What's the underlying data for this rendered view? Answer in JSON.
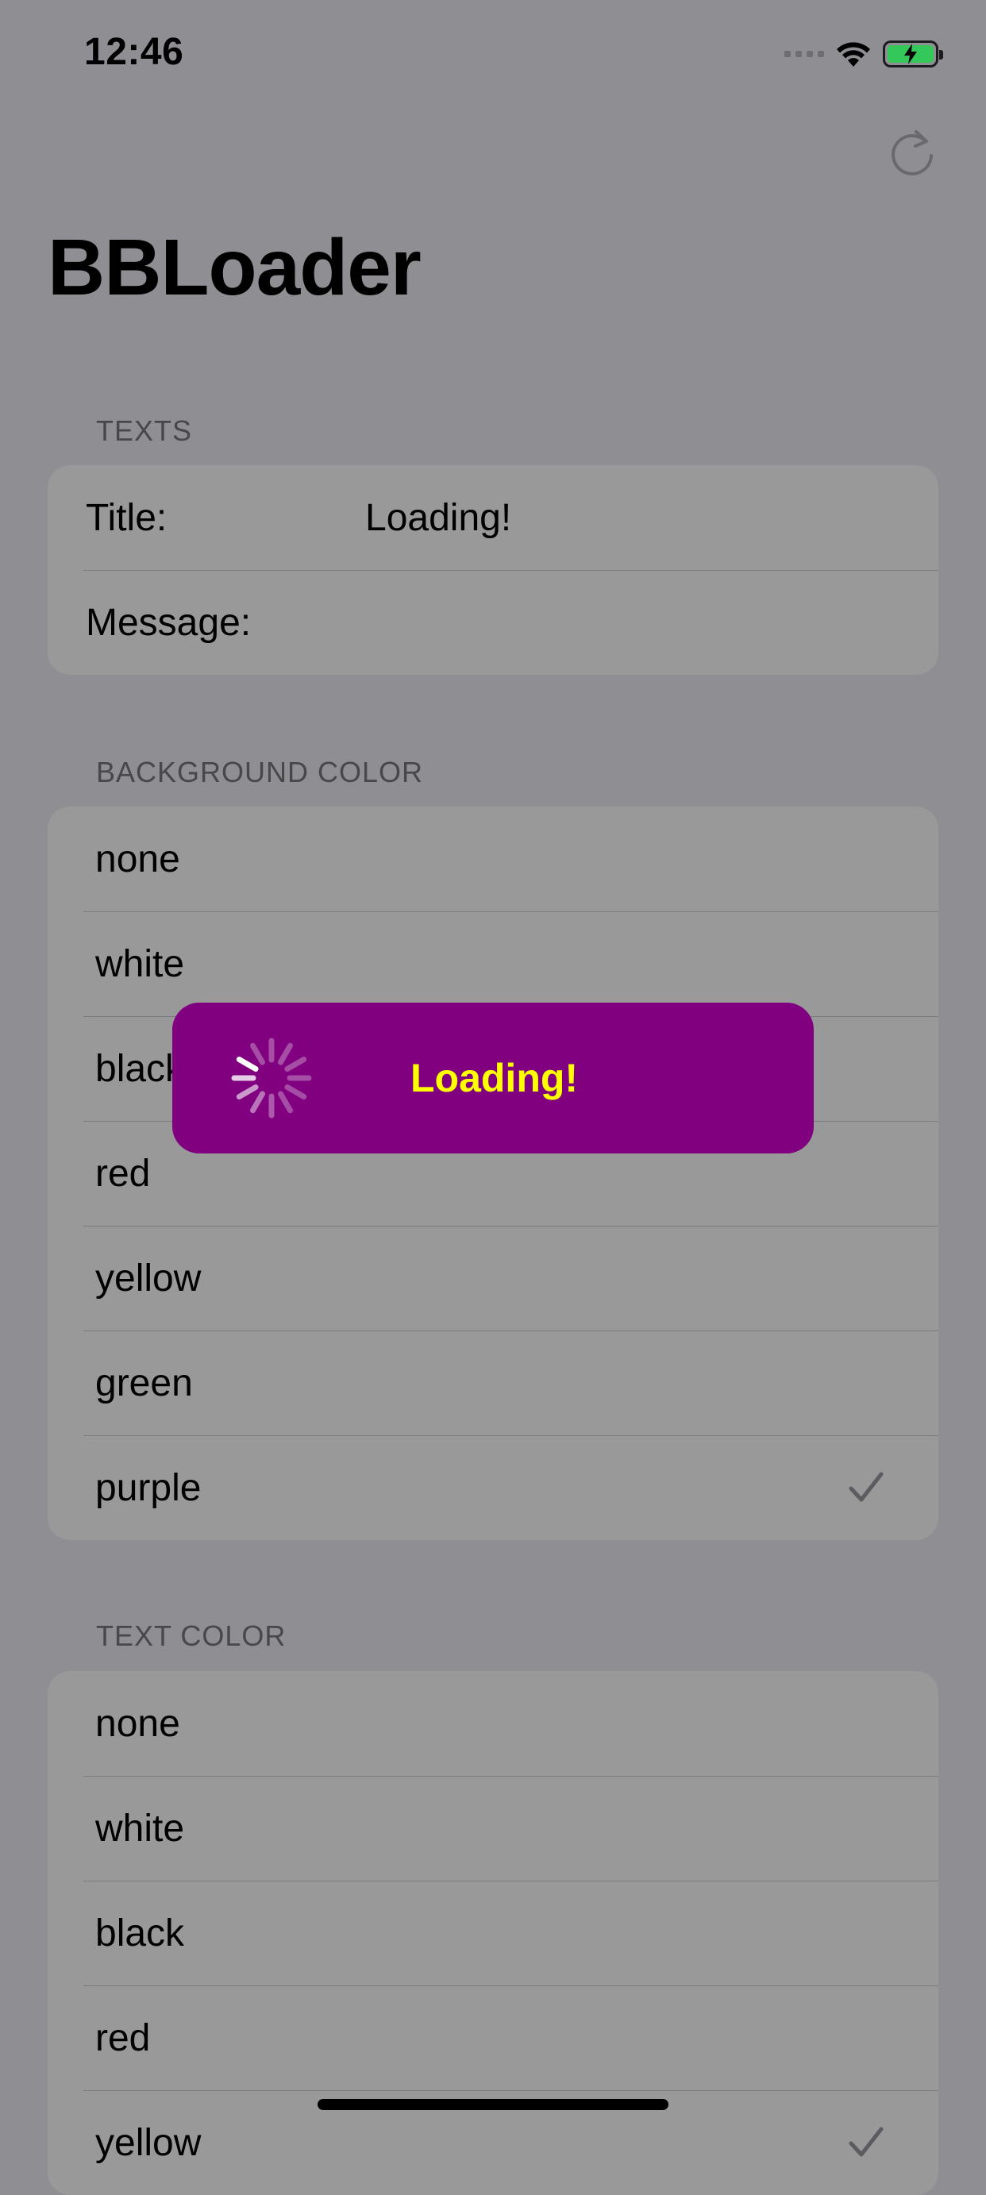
{
  "status_bar": {
    "time": "12:46"
  },
  "nav": {
    "title": "BBLoader",
    "refresh_icon": "refresh-icon"
  },
  "texts_section": {
    "header": "TEXTS",
    "title_label": "Title:",
    "title_value": "Loading!",
    "message_label": "Message:",
    "message_value": ""
  },
  "background_section": {
    "header": "BACKGROUND COLOR",
    "options": [
      "none",
      "white",
      "black",
      "red",
      "yellow",
      "green",
      "purple"
    ],
    "selected": "purple"
  },
  "text_color_section": {
    "header": "TEXT COLOR",
    "options": [
      "none",
      "white",
      "black",
      "red",
      "yellow"
    ],
    "selected": "yellow"
  },
  "loader": {
    "title": "Loading!",
    "background_color": "#800080",
    "text_color": "#ffff00",
    "spinner_icon": "activity-spinner-icon"
  },
  "colors": {
    "dim_background": "#8e8e93",
    "cell_background": "#999999",
    "battery_green": "#34c759"
  }
}
